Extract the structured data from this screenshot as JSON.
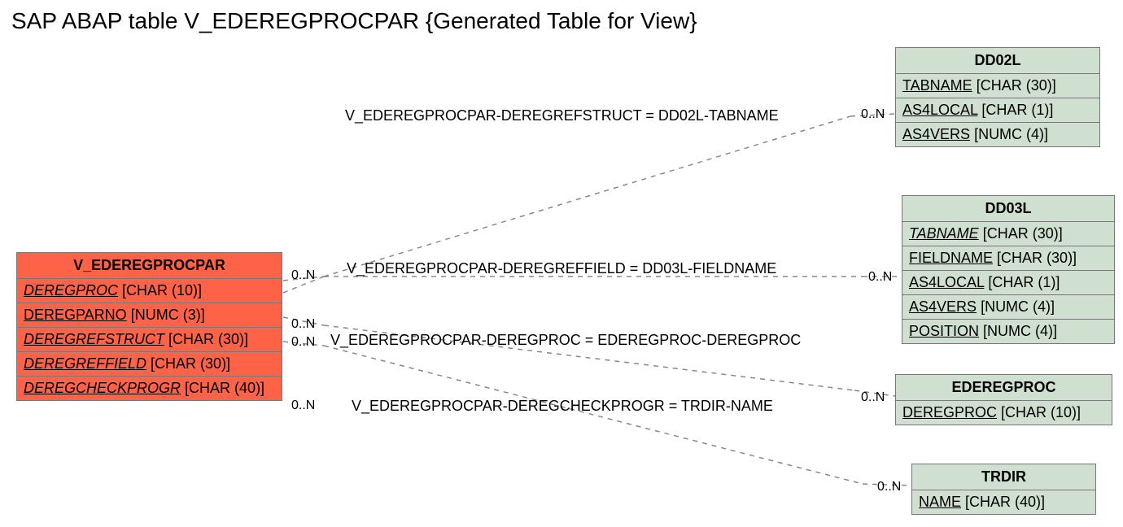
{
  "title": "SAP ABAP table V_EDEREGPROCPAR {Generated Table for View}",
  "main_entity": {
    "name": "V_EDEREGPROCPAR",
    "fields": [
      {
        "name": "DEREGPROC",
        "type": "[CHAR (10)]"
      },
      {
        "name": "DEREGPARNO",
        "type": "[NUMC (3)]"
      },
      {
        "name": "DEREGREFSTRUCT",
        "type": "[CHAR (30)]"
      },
      {
        "name": "DEREGREFFIELD",
        "type": "[CHAR (30)]"
      },
      {
        "name": "DEREGCHECKPROGR",
        "type": "[CHAR (40)]"
      }
    ]
  },
  "rel1": {
    "label": "V_EDEREGPROCPAR-DEREGREFSTRUCT = DD02L-TABNAME",
    "card_left": "0..N",
    "card_right": "0..N",
    "target": {
      "name": "DD02L",
      "fields": [
        {
          "name": "TABNAME",
          "type": "[CHAR (30)]"
        },
        {
          "name": "AS4LOCAL",
          "type": "[CHAR (1)]"
        },
        {
          "name": "AS4VERS",
          "type": "[NUMC (4)]"
        }
      ]
    }
  },
  "rel2": {
    "label": "V_EDEREGPROCPAR-DEREGREFFIELD = DD03L-FIELDNAME",
    "card_left": "0..N",
    "card_right": "0..N",
    "target": {
      "name": "DD03L",
      "fields": [
        {
          "name": "TABNAME",
          "type": "[CHAR (30)]",
          "italic": true
        },
        {
          "name": "FIELDNAME",
          "type": "[CHAR (30)]"
        },
        {
          "name": "AS4LOCAL",
          "type": "[CHAR (1)]"
        },
        {
          "name": "AS4VERS",
          "type": "[NUMC (4)]"
        },
        {
          "name": "POSITION",
          "type": "[NUMC (4)]"
        }
      ]
    }
  },
  "rel3": {
    "label": "V_EDEREGPROCPAR-DEREGPROC = EDEREGPROC-DEREGPROC",
    "card_left": "0..N",
    "card_right": "0..N",
    "target": {
      "name": "EDEREGPROC",
      "fields": [
        {
          "name": "DEREGPROC",
          "type": "[CHAR (10)]"
        }
      ]
    }
  },
  "rel4": {
    "label": "V_EDEREGPROCPAR-DEREGCHECKPROGR = TRDIR-NAME",
    "card_left": "0..N",
    "card_right": "0..N",
    "target": {
      "name": "TRDIR",
      "fields": [
        {
          "name": "NAME",
          "type": "[CHAR (40)]"
        }
      ]
    }
  }
}
